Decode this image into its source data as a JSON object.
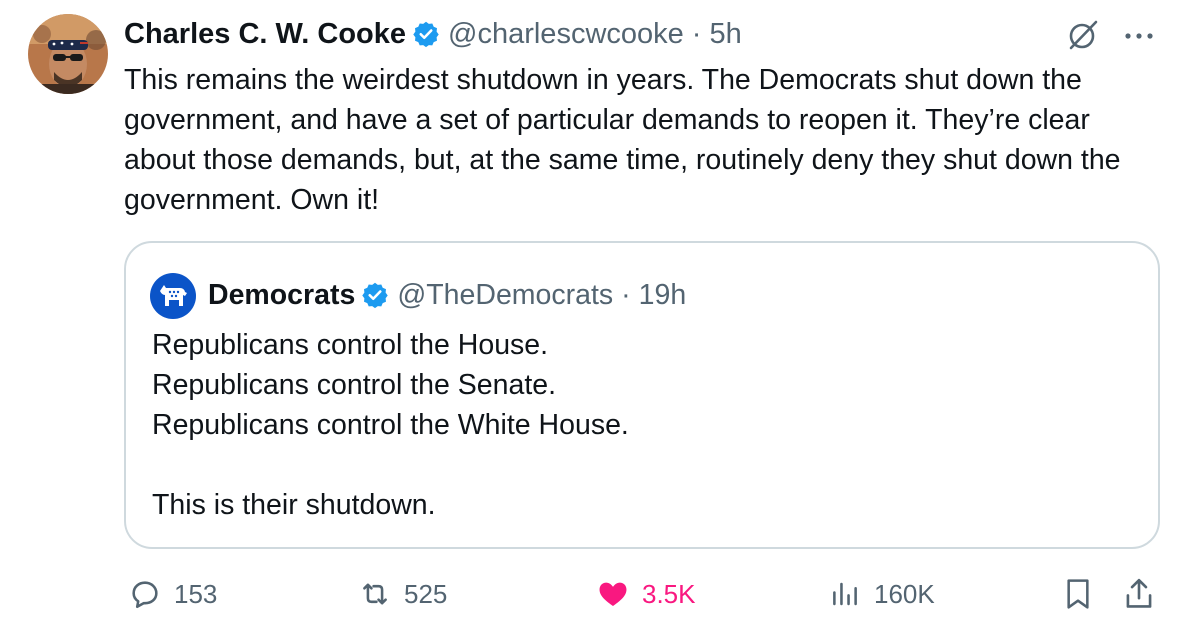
{
  "author": {
    "name": "Charles C. W. Cooke",
    "handle": "@charlescwcooke",
    "separator": "·",
    "time": "5h"
  },
  "tweet_text": "This remains the weirdest shutdown in years. The Democrats shut down the government, and have a set of particular demands to reopen it. They’re clear about those demands, but, at the same time, routinely deny they shut down the government. Own it!",
  "quote": {
    "name": "Democrats",
    "handle": "@TheDemocrats",
    "separator": "·",
    "time": "19h",
    "lines": [
      "Republicans control the House.",
      "Republicans control the Senate.",
      "Republicans control the White House.",
      "",
      "This is their shutdown."
    ]
  },
  "actions": {
    "replies": "153",
    "reposts": "525",
    "likes": "3.5K",
    "views": "160K"
  },
  "icons": {
    "verified": "verified-badge-icon",
    "grok": "grok-icon",
    "more": "more-icon",
    "reply": "reply-icon",
    "repost": "repost-icon",
    "like": "heart-icon",
    "views": "views-icon",
    "bookmark": "bookmark-icon",
    "share": "share-icon"
  },
  "colors": {
    "text": "#0f1419",
    "secondary": "#536471",
    "verified": "#1d9bf0",
    "like": "#f91880",
    "border": "#cfd9de",
    "democrats_blue": "#0b54c8"
  }
}
